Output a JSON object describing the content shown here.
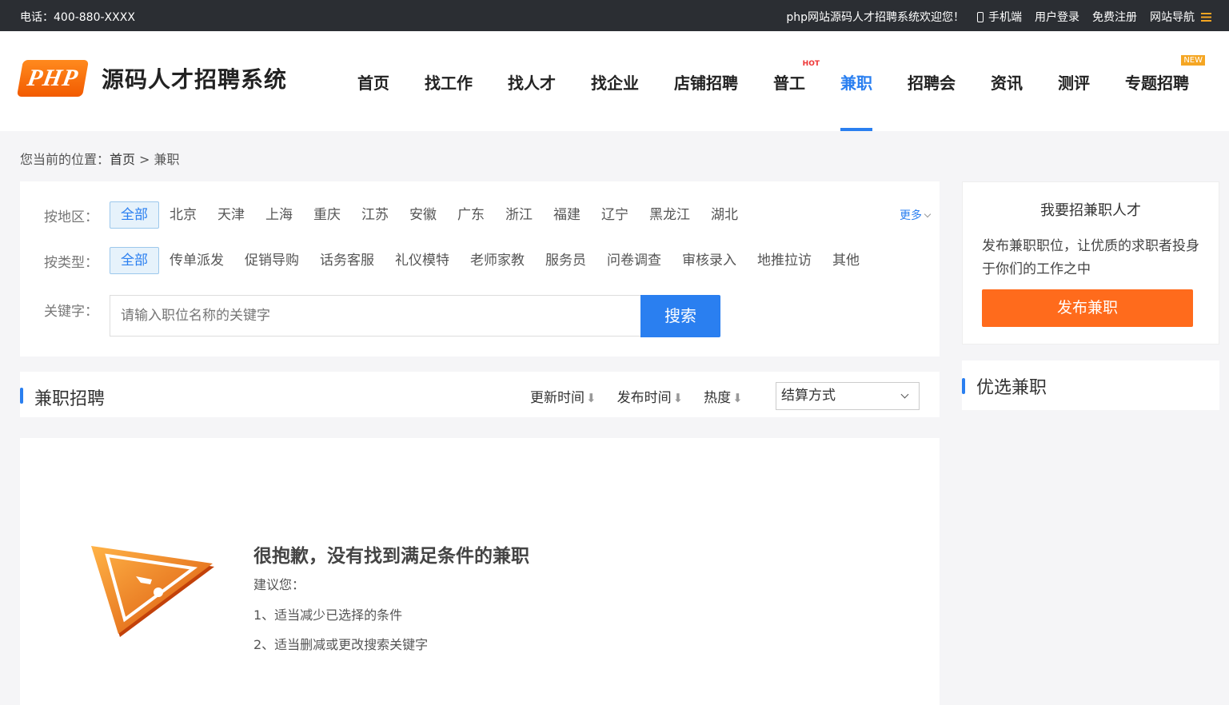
{
  "topbar": {
    "phone": "电话：400-880-XXXX",
    "welcome": "php网站源码人才招聘系统欢迎您！",
    "mobile": "手机端",
    "login": "用户登录",
    "register": "免费注册",
    "sitenav": "网站导航"
  },
  "logo": {
    "badge": "PHP",
    "text": "源码人才招聘系统"
  },
  "nav": {
    "items": [
      "首页",
      "找工作",
      "找人才",
      "找企业",
      "店铺招聘",
      "普工",
      "兼职",
      "招聘会",
      "资讯",
      "测评",
      "专题招聘"
    ],
    "hot_tag": "HOT",
    "new_tag": "NEW",
    "active": "兼职"
  },
  "breadcrumb": {
    "prefix": "您当前的位置：",
    "home": "首页",
    "sep": ">",
    "current": "兼职"
  },
  "filter": {
    "area_label": "按地区：",
    "areas": [
      "全部",
      "北京",
      "天津",
      "上海",
      "重庆",
      "江苏",
      "安徽",
      "广东",
      "浙江",
      "福建",
      "辽宁",
      "黑龙江",
      "湖北"
    ],
    "more": "更多",
    "type_label": "按类型：",
    "types": [
      "全部",
      "传单派发",
      "促销导购",
      "话务客服",
      "礼仪模特",
      "老师家教",
      "服务员",
      "问卷调查",
      "审核录入",
      "地推拉访",
      "其他"
    ],
    "keyword_label": "关键字：",
    "keyword_placeholder": "请输入职位名称的关键字",
    "search_button": "搜索"
  },
  "list": {
    "title": "兼职招聘",
    "sorts": [
      "更新时间",
      "发布时间",
      "热度"
    ],
    "sort_arrow": "⬇",
    "settle_select": "结算方式"
  },
  "empty": {
    "title": "很抱歉，没有找到满足条件的兼职",
    "suggest": "建议您：",
    "tip1": "1、适当减少已选择的条件",
    "tip2": "2、适当删减或更改搜索关键字"
  },
  "sidebar": {
    "recruit_title": "我要招兼职人才",
    "recruit_desc": "发布兼职职位，让优质的求职者投身于你们的工作之中",
    "publish_button": "发布兼职",
    "featured_title": "优选兼职"
  },
  "colors": {
    "accent": "#2a7ff0",
    "orange": "#ff6b1c",
    "topbar": "#2b2e33"
  }
}
